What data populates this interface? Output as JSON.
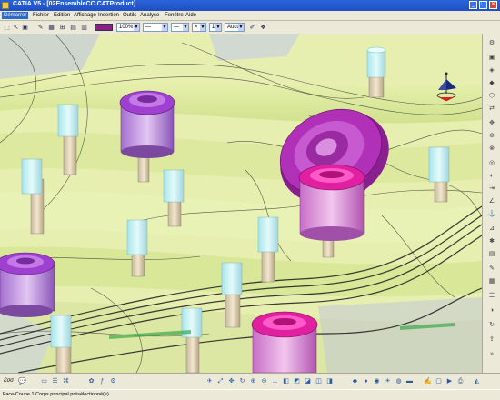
{
  "window": {
    "title": "CATIA V5 - [02EnsembleCC.CATProduct]",
    "minimize_glyph": "_",
    "restore_glyph": "❐",
    "close_glyph": "✕"
  },
  "menu": {
    "items": [
      "Démarrer",
      "Fichier",
      "Edition",
      "Affichage",
      "Insertion",
      "Outils",
      "Analyse",
      "Fenêtre",
      "Aide"
    ]
  },
  "toolbar": {
    "zoom_value": "100%",
    "line_value": "1",
    "layer_value": "Aucun",
    "icons": [
      "select-icon",
      "pointer-icon",
      "fill-icon",
      "brush-icon",
      "style-icon",
      "snap-icon"
    ],
    "color_swatch": "#8a1f8a"
  },
  "command": {
    "label": "Ԑσσ"
  },
  "status": {
    "text": "Face/Coupe.1/Corps principal présélectionné(e)"
  },
  "colors": {
    "titlebar": "#1f4fc4",
    "background_fill": "#dfe9a8",
    "part_magenta": "#c020a0",
    "part_purple": "#9a44c8",
    "pin_cyan": "#bfeeee"
  }
}
